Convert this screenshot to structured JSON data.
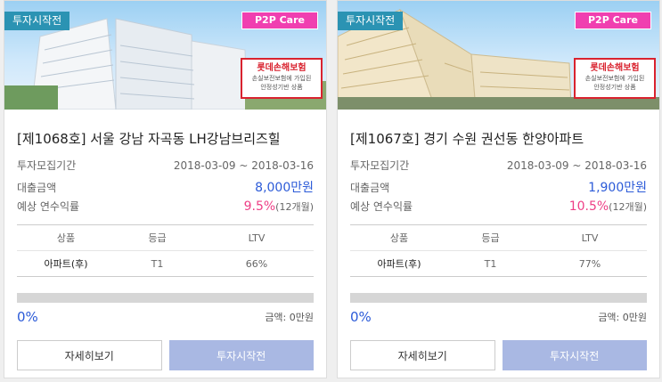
{
  "cards": [
    {
      "status_badge": "투자시작전",
      "p2p_badge": "P2P Care",
      "insurance": {
        "title": "롯데손해보험",
        "line1": "손실보전보험에 가입된",
        "line2": "안정성기반 상품"
      },
      "title": "[제1068호] 서울 강남 자곡동 LH강남브리즈힐",
      "period_label": "투자모집기간",
      "period_value": "2018-03-09 ~ 2018-03-16",
      "loan_label": "대출금액",
      "loan_value": "8,000만원",
      "yield_label": "예상 연수익률",
      "yield_value": "9.5%",
      "yield_term": "(12개월)",
      "table_headers": {
        "product": "상품",
        "grade": "등급",
        "ltv": "LTV"
      },
      "table_row": {
        "product": "아파트(후)",
        "grade": "T1",
        "ltv": "66%"
      },
      "progress_fraction": 0,
      "progress_text": "0%",
      "amount_text": "금액: 0만원",
      "detail_button": "자세히보기",
      "invest_button": "투자시작전"
    },
    {
      "status_badge": "투자시작전",
      "p2p_badge": "P2P Care",
      "insurance": {
        "title": "롯데손해보험",
        "line1": "손실보전보험에 가입된",
        "line2": "안정성기반 상품"
      },
      "title": "[제1067호] 경기 수원 권선동 한양아파트",
      "period_label": "투자모집기간",
      "period_value": "2018-03-09 ~ 2018-03-16",
      "loan_label": "대출금액",
      "loan_value": "1,900만원",
      "yield_label": "예상 연수익률",
      "yield_value": "10.5%",
      "yield_term": "(12개월)",
      "table_headers": {
        "product": "상품",
        "grade": "등급",
        "ltv": "LTV"
      },
      "table_row": {
        "product": "아파트(후)",
        "grade": "T1",
        "ltv": "77%"
      },
      "progress_fraction": 0,
      "progress_text": "0%",
      "amount_text": "금액: 0만원",
      "detail_button": "자세히보기",
      "invest_button": "투자시작전"
    }
  ]
}
